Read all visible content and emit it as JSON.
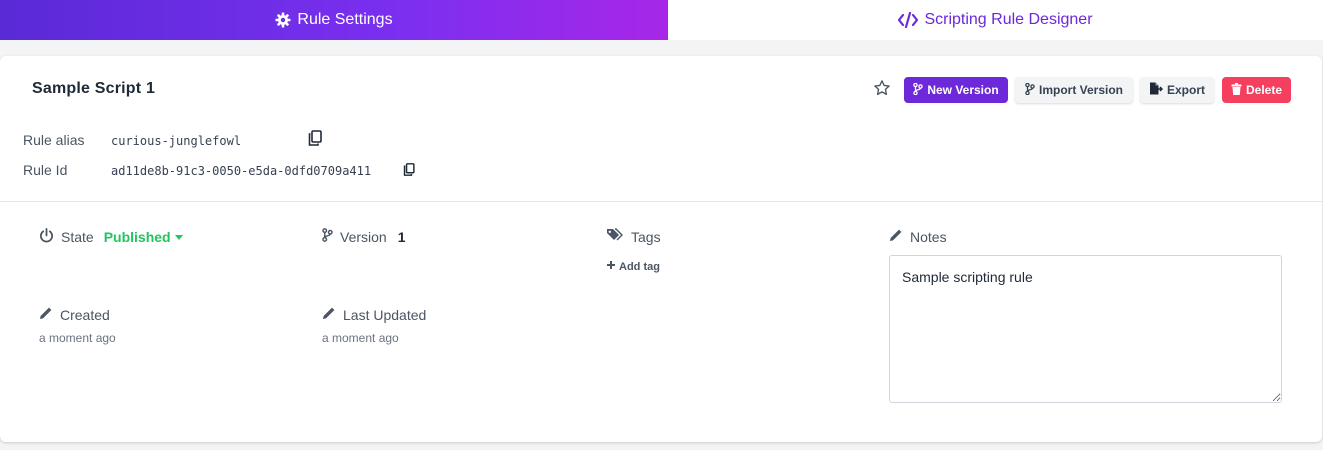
{
  "tabs": [
    {
      "label": "Rule Settings",
      "icon": "gear-icon",
      "active": true
    },
    {
      "label": "Scripting Rule Designer",
      "icon": "code-icon",
      "active": false
    }
  ],
  "rule": {
    "title": "Sample Script 1",
    "alias_label": "Rule alias",
    "alias_value": "curious-junglefowl",
    "id_label": "Rule Id",
    "id_value": "ad11de8b-91c3-0050-e5da-0dfd0709a411"
  },
  "actions": {
    "favorite_icon": "star-icon",
    "new_version": "New Version",
    "import_version": "Import Version",
    "export": "Export",
    "delete": "Delete"
  },
  "fields": {
    "state_label": "State",
    "state_value": "Published",
    "version_label": "Version",
    "version_value": "1",
    "tags_label": "Tags",
    "add_tag": "Add tag",
    "notes_label": "Notes",
    "notes_value": "Sample scripting rule",
    "created_label": "Created",
    "created_value": "a moment ago",
    "updated_label": "Last Updated",
    "updated_value": "a moment ago"
  },
  "colors": {
    "accent": "#6d28d9",
    "published": "#22c55e",
    "delete": "#f43f5e"
  }
}
